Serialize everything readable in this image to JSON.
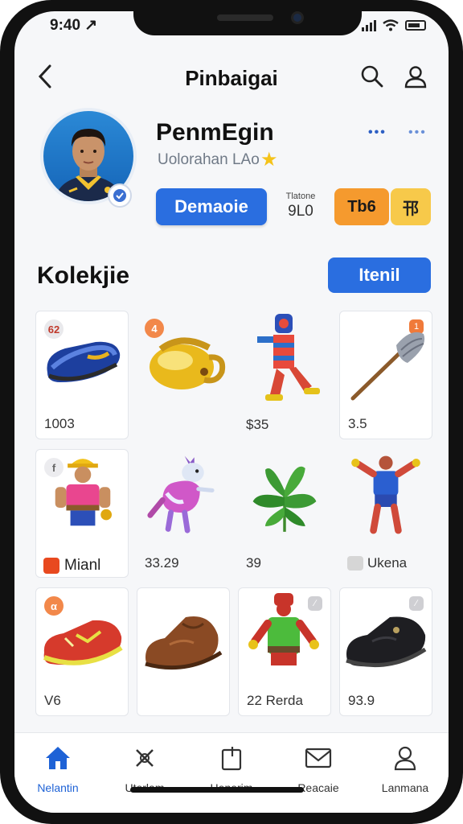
{
  "status": {
    "time": "9:40 ↗"
  },
  "topbar": {
    "title": "Pinbaigai"
  },
  "profile": {
    "name": "PenmEgin",
    "subtitle": "Uolorahan LAo",
    "primary_button": "Demaoie",
    "stat_label": "Tlatone",
    "stat_value": "9L0",
    "orange_button": "Tb6",
    "yellow_button": "邗"
  },
  "section": {
    "title": "Kolekjie",
    "button": "Itenil"
  },
  "items": [
    {
      "price": "1003",
      "art": "blue-sneaker",
      "badge": "62",
      "badge_color": "#e9e9ec"
    },
    {
      "price": "",
      "art": "golden-lamp",
      "badge": "4",
      "badge_color": "#f2884a"
    },
    {
      "price": "$35",
      "art": "striped-figure"
    },
    {
      "price": "3.5",
      "art": "broom",
      "badge_r": "1",
      "badge_r_color": "#f07a3a"
    },
    {
      "price": "",
      "art": "miner-figure",
      "badge": "f",
      "badge_color": "#ececef"
    },
    {
      "price": "33.29",
      "art": "pink-creature"
    },
    {
      "price": "39",
      "art": "green-plant"
    },
    {
      "price": "Ukena",
      "art": "blue-figure",
      "tag_color": "#d6d6d6"
    },
    {
      "price": "Mianl",
      "art": "miner-figure-2",
      "tag_color": "#e8491f"
    },
    {
      "price": "V6",
      "art": "red-shoe",
      "badge": "α",
      "badge_color": "#f2884a"
    },
    {
      "price": "",
      "art": "brown-shoe"
    },
    {
      "price": "22 Rerda",
      "art": "green-figure",
      "badge_r": "∕",
      "badge_r_color": "#cfcfd3"
    },
    {
      "price": "93.9",
      "art": "black-shoe",
      "badge_r": "∕",
      "badge_r_color": "#cfcfd3"
    }
  ],
  "tabs": [
    {
      "label": "Nelantin",
      "icon": "home-icon",
      "active": true
    },
    {
      "label": "Uterlam",
      "icon": "cross-icon"
    },
    {
      "label": "Henerim",
      "icon": "tag-icon"
    },
    {
      "label": "Reacaie",
      "icon": "mail-icon"
    },
    {
      "label": "Lanmana",
      "icon": "person-icon"
    }
  ],
  "colors": {
    "accent": "#2a6ee0",
    "orange": "#f59a2e",
    "yellow": "#f7c94a"
  }
}
